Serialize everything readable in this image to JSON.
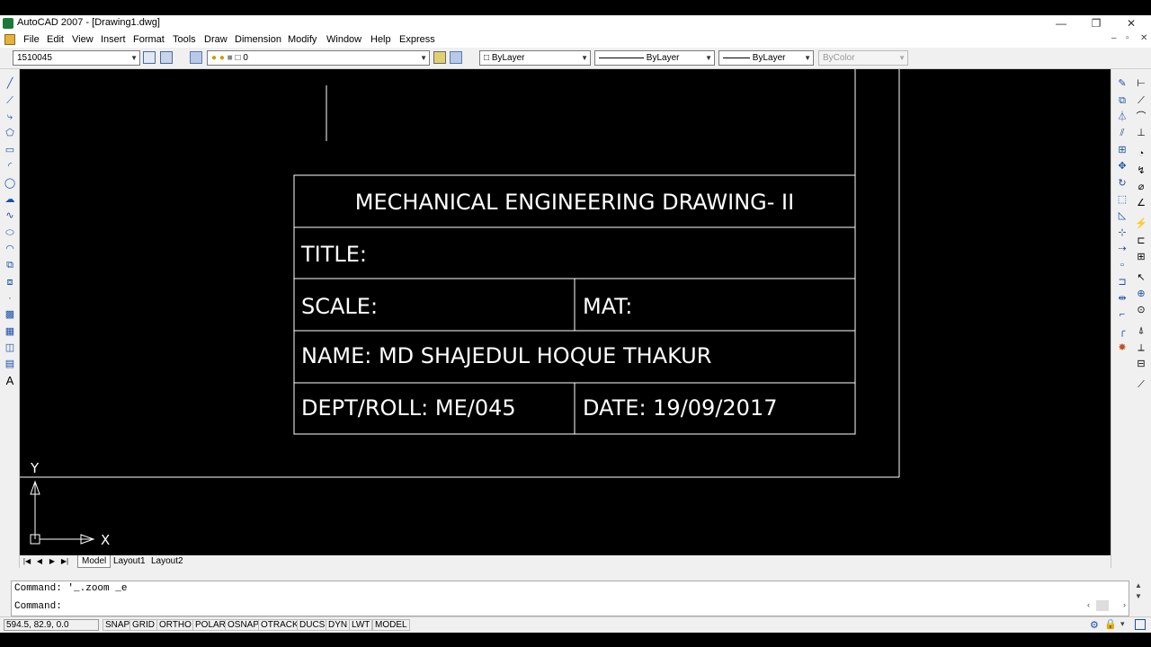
{
  "window": {
    "title": "AutoCAD 2007 - [Drawing1.dwg]",
    "minimize": "—",
    "restore": "❐",
    "close": "✕"
  },
  "menu": {
    "items": [
      "File",
      "Edit",
      "View",
      "Insert",
      "Format",
      "Tools",
      "Draw",
      "Dimension",
      "Modify",
      "Window",
      "Help",
      "Express"
    ],
    "mdi_minimize": "–",
    "mdi_restore": "▫",
    "mdi_close": "✕"
  },
  "toolbar": {
    "workspace_value": "1510045",
    "layer_value": "0",
    "color_value": "ByLayer",
    "linetype_value": "ByLayer",
    "lineweight_value": "ByLayer",
    "plotstyle_value": "ByColor",
    "icons": [
      "zoom-realtime-icon",
      "zoom-window-icon",
      "layer-manager-icon",
      "layer-state-icons",
      "make-object-layer-icon",
      "layer-previous-icon"
    ]
  },
  "drawing": {
    "title_block": {
      "heading": "MECHANICAL ENGINEERING DRAWING- II",
      "title_label": "TITLE:",
      "scale_label": "SCALE:",
      "mat_label": "MAT:",
      "name_line": "NAME: MD SHAJEDUL HOQUE THAKUR",
      "dept_line": "DEPT/ROLL: ME/045",
      "date_line": "DATE: 19/09/2017"
    },
    "ucs": {
      "x_label": "X",
      "y_label": "Y"
    },
    "line_color": "#ffffff",
    "background": "#000000"
  },
  "left_toolbar": {
    "icons": [
      "line-icon",
      "construction-line-icon",
      "polyline-icon",
      "polygon-icon",
      "rectangle-icon",
      "arc-icon",
      "circle-icon",
      "revision-cloud-icon",
      "spline-icon",
      "ellipse-icon",
      "ellipse-arc-icon",
      "insert-block-icon",
      "make-block-icon",
      "point-icon",
      "hatch-icon",
      "gradient-icon",
      "region-icon",
      "table-icon",
      "multiline-text-icon"
    ],
    "text_icon_glyph": "A"
  },
  "right_toolbar": {
    "modify_icons": [
      "erase-icon",
      "copy-icon",
      "mirror-icon",
      "offset-icon",
      "array-icon",
      "move-icon",
      "rotate-icon",
      "scale-icon",
      "stretch-icon",
      "trim-icon",
      "extend-icon",
      "break-at-point-icon",
      "break-icon",
      "join-icon",
      "chamfer-icon",
      "fillet-icon",
      "explode-icon"
    ],
    "dimension_icons": [
      "linear-dimension-icon",
      "aligned-dimension-icon",
      "arc-length-icon",
      "ordinate-dimension-icon",
      "radius-dimension-icon",
      "jogged-dimension-icon",
      "diameter-dimension-icon",
      "angular-dimension-icon",
      "quick-dimension-icon",
      "baseline-dimension-icon",
      "continue-dimension-icon",
      "quick-leader-icon",
      "tolerance-icon",
      "center-mark-icon",
      "dimension-edit-icon",
      "dimension-text-edit-icon",
      "dimension-update-icon",
      "dimension-style-icon"
    ]
  },
  "tabs": {
    "nav": [
      "|◀",
      "◀",
      "▶",
      "▶|"
    ],
    "items": [
      "Model",
      "Layout1",
      "Layout2"
    ],
    "active": "Model"
  },
  "command": {
    "history": "Command: '_.zoom _e",
    "prompt": "Command:"
  },
  "status": {
    "coords": "594.5, 82.9, 0.0",
    "buttons": [
      "SNAP",
      "GRID",
      "ORTHO",
      "POLAR",
      "OSNAP",
      "OTRACK",
      "DUCS",
      "DYN",
      "LWT",
      "MODEL"
    ]
  }
}
